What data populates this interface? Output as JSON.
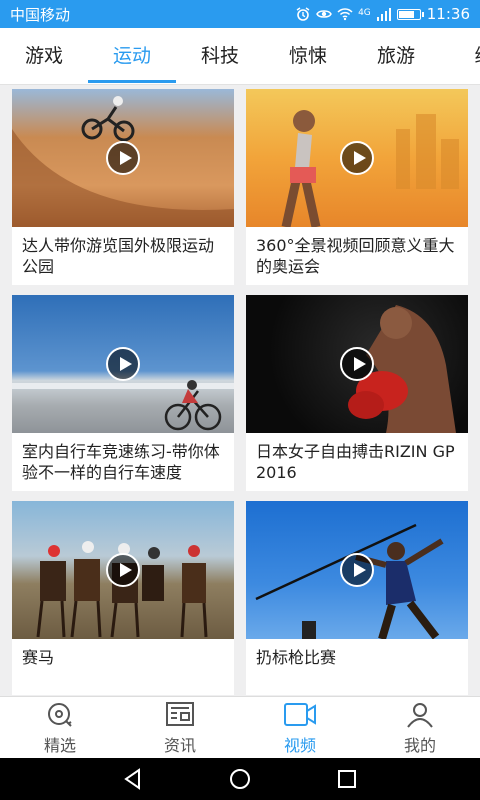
{
  "status_bar": {
    "carrier": "中国移动",
    "network": "4G",
    "time": "11:36",
    "battery_level": 0.8
  },
  "tabs": [
    {
      "label": "游戏",
      "active": false
    },
    {
      "label": "运动",
      "active": true
    },
    {
      "label": "科技",
      "active": false
    },
    {
      "label": "惊悚",
      "active": false
    },
    {
      "label": "旅游",
      "active": false
    },
    {
      "label": "综",
      "active": false
    }
  ],
  "feed": {
    "cards": [
      {
        "title": "达人带你游览国外极限运动公园",
        "thumb": "bmx-halfpipe"
      },
      {
        "title": "360°全景视频回顾意义重大的奥运会",
        "thumb": "runner-sunset"
      },
      {
        "title": "室内自行车竞速练习-带你体验不一样的自行车速度",
        "thumb": "cyclist"
      },
      {
        "title": "日本女子自由搏击RIZIN GP 2016",
        "thumb": "boxer"
      },
      {
        "title": "赛马",
        "thumb": "horse-racing"
      },
      {
        "title": "扔标枪比赛",
        "thumb": "javelin"
      }
    ]
  },
  "bottom_nav": [
    {
      "label": "精选",
      "icon": "discover-icon",
      "active": false
    },
    {
      "label": "资讯",
      "icon": "news-icon",
      "active": false
    },
    {
      "label": "视频",
      "icon": "video-icon",
      "active": true
    },
    {
      "label": "我的",
      "icon": "profile-icon",
      "active": false
    }
  ],
  "colors": {
    "accent": "#2a9bef",
    "text": "#222222",
    "background": "#efeff0"
  }
}
